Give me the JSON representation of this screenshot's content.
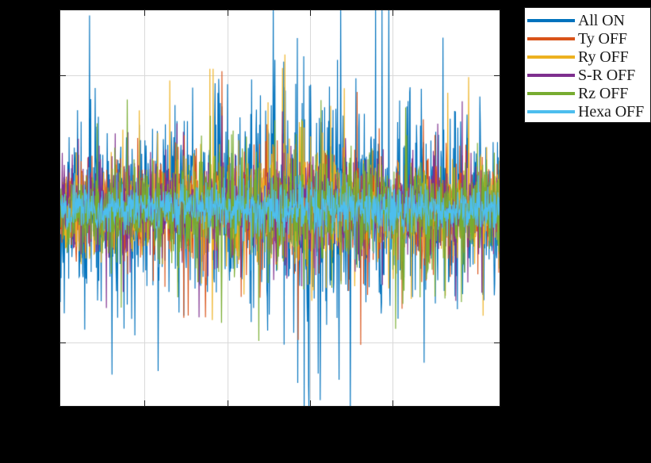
{
  "figure": {
    "background_color": "#000000",
    "axes_background_color": "#ffffff",
    "axes_border_color": "#1a1a1a",
    "grid_color": "#d9d9d9"
  },
  "legend": {
    "visible": true,
    "position": "northeast-outside",
    "background_color": "#ffffff",
    "border_color": "#1a1a1a",
    "entries": [
      {
        "label": "All ON",
        "color": "#0072BD"
      },
      {
        "label": "Ty OFF",
        "color": "#D95319"
      },
      {
        "label": "Ry OFF",
        "color": "#EDB120"
      },
      {
        "label": "S-R OFF",
        "color": "#7E2F8E"
      },
      {
        "label": "Rz OFF",
        "color": "#77AC30"
      },
      {
        "label": "Hexa OFF",
        "color": "#4DBEEE"
      }
    ]
  },
  "chart_data": {
    "type": "line",
    "title": "",
    "subtitle": "",
    "xlabel": "",
    "ylabel": "",
    "xlim": [
      0,
      1
    ],
    "ylim": [
      -1,
      1
    ],
    "xtick_labels": [],
    "ytick_labels": [],
    "grid": true,
    "x_gridline_positions": [
      0.1906,
      0.3795,
      0.5665,
      0.7536
    ],
    "y_gridline_positions": [
      0.8363,
      0.1637
    ],
    "legend_position": "northeast-outside",
    "description": "Six overlaid dense broadband time-domain noise traces spanning the full x range; amplitude envelope is largest near mid-plot. Series drawn in order with Hexa OFF last, forming a solid light-blue band through the centre.",
    "series": [
      {
        "name": "All ON",
        "color": "#0072BD",
        "draw_order": 1,
        "envelope_peak": 1.0,
        "envelope_rms": 0.42,
        "envelope_profile": [
          0.62,
          0.7,
          0.66,
          0.72,
          0.78,
          0.85,
          0.97,
          0.92,
          0.8,
          0.74,
          0.7,
          0.66
        ]
      },
      {
        "name": "Ty OFF",
        "color": "#D95319",
        "draw_order": 2,
        "envelope_peak": 0.72,
        "envelope_rms": 0.33,
        "envelope_profile": [
          0.5,
          0.55,
          0.52,
          0.56,
          0.6,
          0.64,
          0.7,
          0.66,
          0.6,
          0.56,
          0.54,
          0.52
        ]
      },
      {
        "name": "Ry OFF",
        "color": "#EDB120",
        "draw_order": 3,
        "envelope_peak": 0.7,
        "envelope_rms": 0.32,
        "envelope_profile": [
          0.48,
          0.53,
          0.5,
          0.55,
          0.58,
          0.62,
          0.68,
          0.64,
          0.58,
          0.55,
          0.52,
          0.5
        ]
      },
      {
        "name": "S-R OFF",
        "color": "#7E2F8E",
        "draw_order": 4,
        "envelope_peak": 0.68,
        "envelope_rms": 0.31,
        "envelope_profile": [
          0.46,
          0.51,
          0.49,
          0.53,
          0.57,
          0.6,
          0.66,
          0.62,
          0.57,
          0.53,
          0.51,
          0.49
        ]
      },
      {
        "name": "Rz OFF",
        "color": "#77AC30",
        "draw_order": 5,
        "envelope_peak": 0.69,
        "envelope_rms": 0.32,
        "envelope_profile": [
          0.47,
          0.52,
          0.5,
          0.54,
          0.58,
          0.61,
          0.67,
          0.63,
          0.58,
          0.54,
          0.52,
          0.5
        ]
      },
      {
        "name": "Hexa OFF",
        "color": "#4DBEEE",
        "draw_order": 6,
        "envelope_peak": 0.46,
        "envelope_rms": 0.24,
        "envelope_profile": [
          0.34,
          0.37,
          0.36,
          0.38,
          0.41,
          0.43,
          0.46,
          0.44,
          0.41,
          0.38,
          0.37,
          0.36
        ]
      }
    ]
  }
}
